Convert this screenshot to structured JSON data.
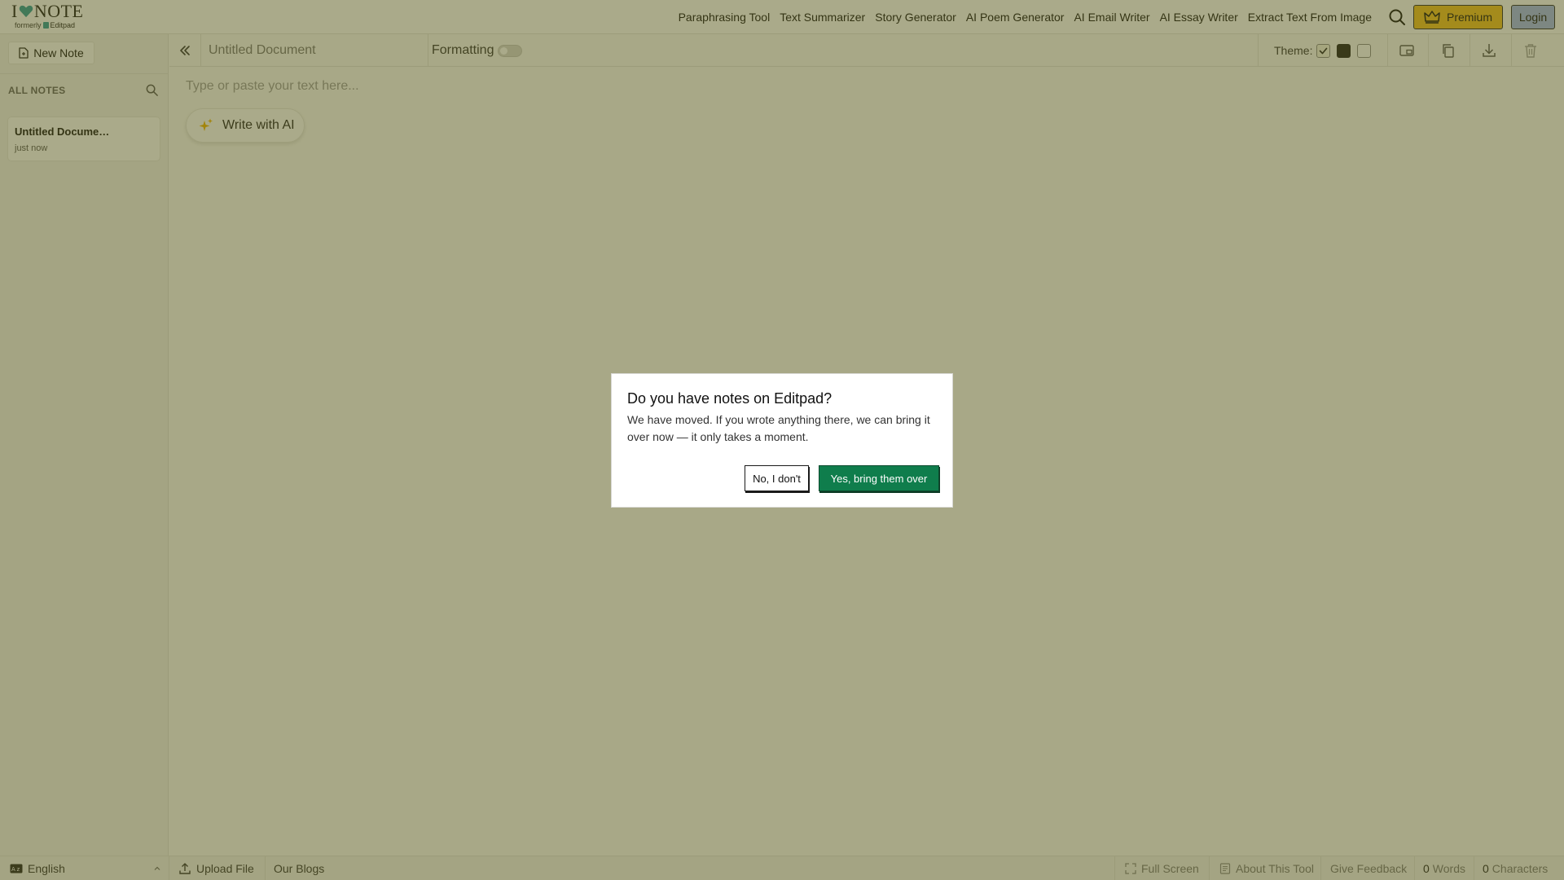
{
  "header": {
    "logo": {
      "prefix": "I",
      "icon": "heart-icon",
      "main": "NOTE",
      "formerly": "formerly",
      "brand": "Editpad"
    },
    "nav": [
      "Paraphrasing Tool",
      "Text Summarizer",
      "Story Generator",
      "AI Poem Generator",
      "AI Email Writer",
      "AI Essay Writer",
      "Extract Text From Image"
    ],
    "search_icon": "search-icon",
    "premium_label": "Premium",
    "premium_icon": "crown-icon",
    "login_label": "Login"
  },
  "sidebar": {
    "new_note_label": "New Note",
    "new_note_icon": "file-icon",
    "all_notes_label": "ALL NOTES",
    "search_icon": "search-icon",
    "notes": [
      {
        "title": "Untitled Docume…",
        "time": "just now"
      }
    ]
  },
  "toolbar": {
    "collapse_icon": "double-chevron-left-icon",
    "doc_title_placeholder": "Untitled Document",
    "formatting_label": "Formatting",
    "formatting_on": false,
    "theme_label": "Theme:",
    "themes": [
      {
        "name": "cream",
        "color": "#f4f4e6",
        "selected": true
      },
      {
        "name": "dark",
        "color": "#1d1d1d",
        "selected": false
      },
      {
        "name": "light",
        "color": "#ffffff",
        "selected": false
      }
    ],
    "icons": [
      "picture-in-picture-icon",
      "copy-icon",
      "download-icon",
      "trash-icon"
    ]
  },
  "editor": {
    "placeholder": "Type or paste your text here...",
    "write_ai_label": "Write with AI",
    "write_ai_icon": "sparkle-icon"
  },
  "footer": {
    "language": "English",
    "language_icon": "language-icon",
    "upload_label": "Upload File",
    "upload_icon": "upload-icon",
    "blogs_label": "Our Blogs",
    "fullscreen_label": "Full Screen",
    "about_label": "About This Tool",
    "feedback_label": "Give Feedback",
    "words_count": "0",
    "words_label": "Words",
    "chars_count": "0",
    "chars_label": "Characters"
  },
  "modal": {
    "title": "Do you have notes on Editpad?",
    "body": "We have moved. If you wrote anything there, we can bring it over now — it only takes a moment.",
    "no_label": "No, I don't",
    "yes_label": "Yes, bring them over"
  },
  "colors": {
    "overlay": "#565616",
    "premium": "#f2c123",
    "login": "#a4b9ee",
    "confirm": "#0f7d4c",
    "accent": "#2e9c9a"
  }
}
